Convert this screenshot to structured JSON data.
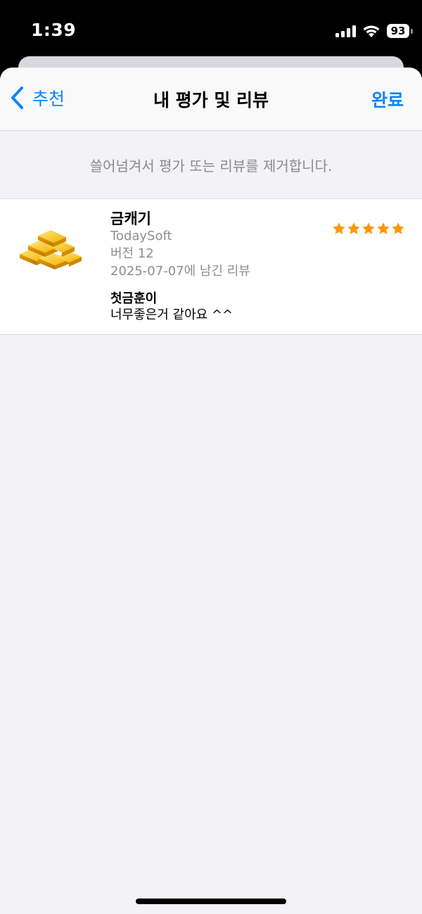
{
  "status_bar": {
    "time": "1:39",
    "battery": "93"
  },
  "nav": {
    "back_label": "추천",
    "title": "내 평가 및 리뷰",
    "done_label": "완료"
  },
  "hint": "쓸어넘겨서 평가 또는 리뷰를 제거합니다.",
  "review": {
    "app_name": "금캐기",
    "developer": "TodaySoft",
    "version": "버전 12",
    "date_text": "2025-07-07에 남긴 리뷰",
    "rating": 5,
    "title": "첫금훈이",
    "body": "너무좋은거 같아요 ^^"
  },
  "colors": {
    "accent": "#0a84ff",
    "star": "#ff9500",
    "background": "#f2f2f7"
  },
  "icons": [
    "chevron-left-icon",
    "signal-icon",
    "wifi-icon",
    "battery-icon",
    "gold-bars-icon",
    "star-icon"
  ]
}
